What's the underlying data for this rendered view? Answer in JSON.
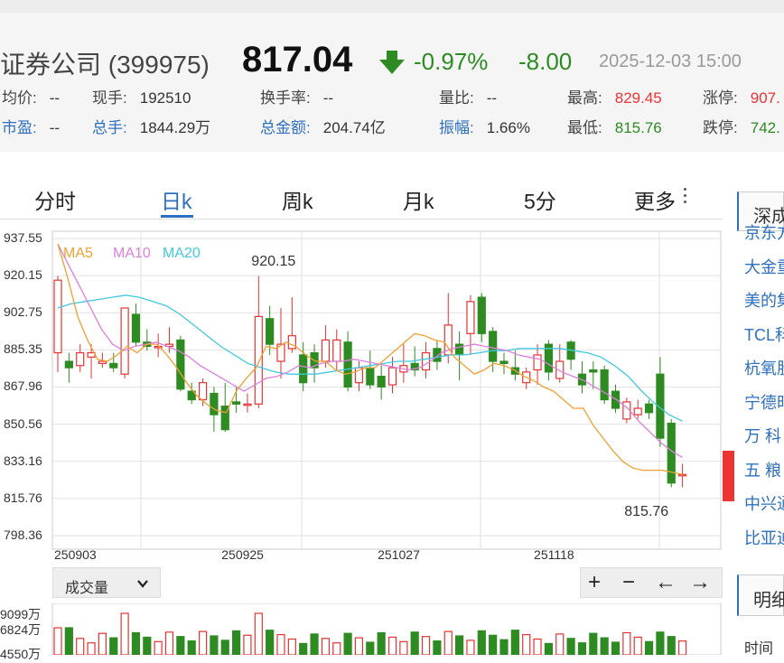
{
  "quote": {
    "name": "证券公司 (399975)",
    "price": "817.04",
    "change_pct": "-0.97%",
    "change_val": "-8.00",
    "timestamp": "2025-12-03 15:00",
    "stats_row1": [
      {
        "label": "均价:",
        "value": "--"
      },
      {
        "label": "现手:",
        "value": "192510"
      },
      {
        "label": "换手率:",
        "value": "--"
      },
      {
        "label": "量比:",
        "value": "--"
      },
      {
        "label": "最高:",
        "value": "829.45"
      },
      {
        "label": "涨停:",
        "value": "907."
      }
    ],
    "stats_row2": [
      {
        "label": "市盈:",
        "value": "--"
      },
      {
        "label": "总手:",
        "value": "1844.29万"
      },
      {
        "label": "总金额:",
        "value": "204.74亿"
      },
      {
        "label": "振幅:",
        "value": "1.66%"
      },
      {
        "label": "最低:",
        "value": "815.76"
      },
      {
        "label": "跌停:",
        "value": "742."
      }
    ],
    "colors": {
      "up": "#e33333",
      "down": "#2e8b22",
      "link": "#2e6fbf"
    }
  },
  "tabs": [
    "分时",
    "日k",
    "周k",
    "月k",
    "5分",
    "更多"
  ],
  "active_tab": "日k",
  "volume_selector": "成交量",
  "zoom_controls": {
    "plus": "+",
    "minus": "−",
    "left": "←",
    "right": "→"
  },
  "volume_axis": [
    "9099万",
    "6824万",
    "4550万"
  ],
  "sidebar": {
    "title": "深成",
    "items": [
      "京东方",
      "大金重",
      "美的集",
      "TCL科",
      "杭氧股",
      "宁德时",
      "万 科",
      "五 粮",
      "中兴通",
      "比亚迪"
    ],
    "section2_title": "明细",
    "section2_label": "时间"
  },
  "chart_data": {
    "type": "candlestick",
    "y_ticks": [
      "937.55",
      "920.15",
      "902.75",
      "885.35",
      "867.96",
      "850.56",
      "833.16",
      "815.76",
      "798.36"
    ],
    "ylim": [
      798.36,
      937.55
    ],
    "x_ticks": [
      {
        "label": "250903",
        "index": 0
      },
      {
        "label": "250925",
        "index": 15
      },
      {
        "label": "251027",
        "index": 29
      },
      {
        "label": "251118",
        "index": 43
      }
    ],
    "annotations": [
      {
        "label": "920.15",
        "index": 18,
        "value": 920.15
      },
      {
        "label": "815.76",
        "index": 55,
        "value": 815.76
      }
    ],
    "legend": [
      {
        "name": "MA5",
        "color": "#f0a030"
      },
      {
        "name": "MA10",
        "color": "#dd80dd"
      },
      {
        "name": "MA20",
        "color": "#40c8e0"
      }
    ],
    "candles": [
      [
        884,
        918,
        875,
        920
      ],
      [
        880,
        877,
        870,
        884
      ],
      [
        878,
        884,
        875,
        888
      ],
      [
        882,
        884,
        872,
        888
      ],
      [
        879,
        880,
        877,
        884
      ],
      [
        879,
        877,
        875,
        884
      ],
      [
        874,
        905,
        872,
        905
      ],
      [
        902,
        889,
        887,
        907
      ],
      [
        889,
        887,
        885,
        895
      ],
      [
        887,
        887,
        882,
        893
      ],
      [
        887,
        888,
        884,
        896
      ],
      [
        890,
        867,
        866,
        892
      ],
      [
        866,
        862,
        860,
        870
      ],
      [
        862,
        870,
        859,
        872
      ],
      [
        865,
        855,
        847,
        868
      ],
      [
        859,
        848,
        847,
        870
      ],
      [
        861,
        860,
        856,
        868
      ],
      [
        860,
        860,
        856,
        865
      ],
      [
        860,
        901,
        858,
        920
      ],
      [
        900,
        888,
        883,
        906
      ],
      [
        880,
        888,
        872,
        905
      ],
      [
        886,
        892,
        884,
        910
      ],
      [
        883,
        870,
        866,
        889
      ],
      [
        884,
        877,
        870,
        888
      ],
      [
        880,
        890,
        877,
        897
      ],
      [
        880,
        890,
        876,
        895
      ],
      [
        889,
        868,
        866,
        894
      ],
      [
        870,
        877,
        866,
        880
      ],
      [
        877,
        869,
        867,
        885
      ],
      [
        873,
        868,
        862,
        878
      ],
      [
        869,
        877,
        865,
        882
      ],
      [
        875,
        878,
        870,
        888
      ],
      [
        879,
        876,
        873,
        887
      ],
      [
        876,
        884,
        872,
        889
      ],
      [
        886,
        880,
        876,
        890
      ],
      [
        883,
        897,
        879,
        912
      ],
      [
        888,
        883,
        871,
        894
      ],
      [
        893,
        908,
        883,
        911
      ],
      [
        910,
        893,
        889,
        912
      ],
      [
        894,
        880,
        875,
        896
      ],
      [
        880,
        879,
        874,
        884
      ],
      [
        877,
        874,
        871,
        885
      ],
      [
        870,
        875,
        867,
        877
      ],
      [
        876,
        883,
        869,
        888
      ],
      [
        888,
        875,
        871,
        890
      ],
      [
        872,
        880,
        870,
        888
      ],
      [
        889,
        881,
        876,
        890
      ],
      [
        874,
        869,
        865,
        880
      ],
      [
        876,
        875,
        867,
        880
      ],
      [
        876,
        862,
        860,
        878
      ],
      [
        866,
        858,
        856,
        869
      ],
      [
        853,
        861,
        851,
        863
      ],
      [
        855,
        858,
        853,
        862
      ],
      [
        860,
        856,
        853,
        862
      ],
      [
        874,
        844,
        840,
        882
      ],
      [
        851,
        823,
        821,
        853
      ],
      [
        827,
        827,
        821,
        832
      ]
    ],
    "ma5": [
      935,
      919,
      901,
      890,
      881,
      880,
      883,
      887,
      884,
      888,
      888,
      883,
      877,
      870,
      864,
      860,
      857,
      856,
      866,
      872,
      877,
      887,
      886,
      889,
      887,
      883,
      880,
      880,
      876,
      874,
      875,
      877,
      877,
      881,
      885,
      889,
      893,
      892,
      890,
      889,
      882,
      878,
      874,
      876,
      879,
      878,
      876,
      873,
      871,
      868,
      866,
      862,
      858,
      858,
      850,
      844,
      838,
      833,
      830,
      829,
      829,
      829,
      828,
      827
    ],
    "ma10": [
      935,
      925,
      915,
      905,
      895,
      888,
      885,
      887,
      888,
      889,
      887,
      885,
      882,
      878,
      875,
      872,
      869,
      866,
      869,
      872,
      873,
      875,
      878,
      877,
      879,
      880,
      880,
      881,
      880,
      879,
      878,
      877,
      876,
      877,
      880,
      884,
      886,
      887,
      888,
      887,
      886,
      885,
      883,
      882,
      881,
      878,
      875,
      873,
      871,
      868,
      865,
      862,
      858,
      852,
      847,
      842,
      838,
      835
    ],
    "ma20": [
      905,
      907,
      908,
      909,
      910,
      911,
      910,
      908,
      906,
      902,
      897,
      892,
      887,
      883,
      879,
      877,
      875,
      874,
      874,
      874,
      875,
      876,
      877,
      878,
      879,
      880,
      880,
      881,
      882,
      883,
      883,
      884,
      885,
      885,
      886,
      886,
      886,
      886,
      885,
      884,
      882,
      878,
      873,
      866,
      860,
      855,
      852
    ]
  }
}
